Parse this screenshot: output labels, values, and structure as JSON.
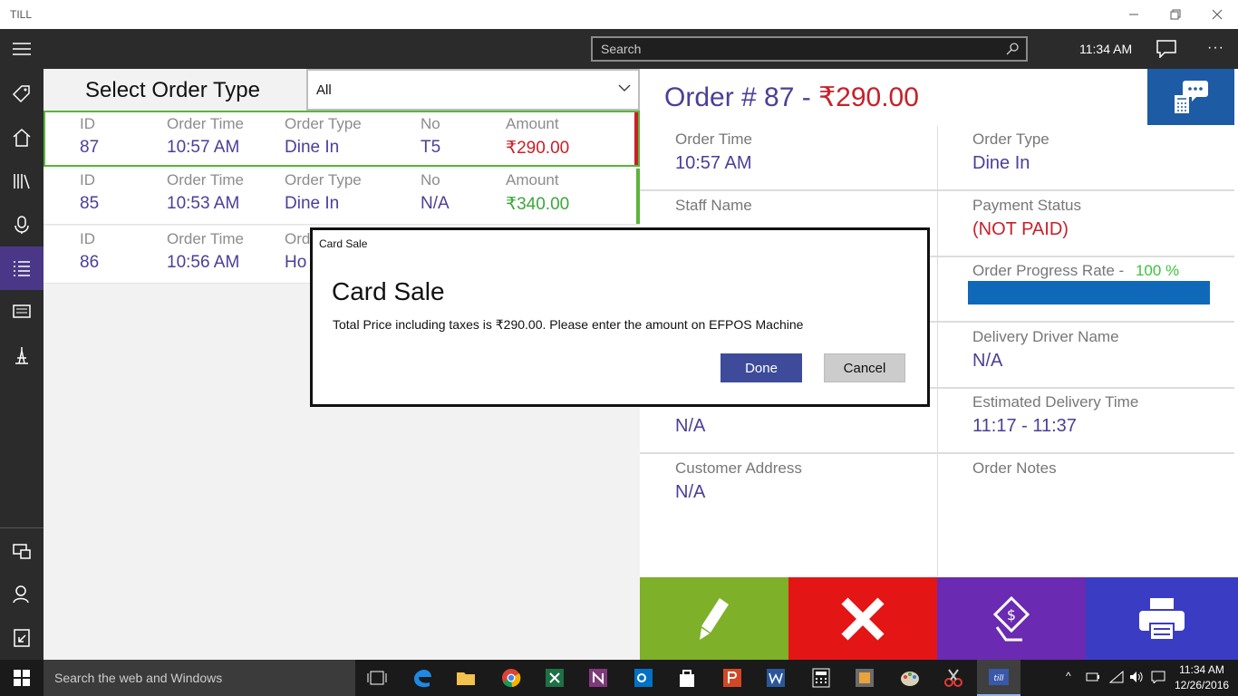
{
  "window": {
    "title": "TILL"
  },
  "cmdbar": {
    "search_placeholder": "Search",
    "time": "11:34 AM"
  },
  "left": {
    "title": "Select Order Type",
    "filter_value": "All",
    "orders": [
      {
        "id_label": "ID",
        "id": "87",
        "time_label": "Order Time",
        "time": "10:57 AM",
        "type_label": "Order Type",
        "type": "Dine In",
        "no_label": "No",
        "no": "T5",
        "amount_label": "Amount",
        "amount": "₹290.00",
        "amount_color": "#c8202a",
        "accent": "#c8202a"
      },
      {
        "id_label": "ID",
        "id": "85",
        "time_label": "Order Time",
        "time": "10:53 AM",
        "type_label": "Order Type",
        "type": "Dine In",
        "no_label": "No",
        "no": "N/A",
        "amount_label": "Amount",
        "amount": "₹340.00",
        "amount_color": "#3aa83a",
        "accent": "#5bb43c"
      },
      {
        "id_label": "ID",
        "id": "86",
        "time_label": "Order Time",
        "time": "10:56 AM",
        "type_label": "Order",
        "type": "Ho",
        "no_label": "",
        "no": "",
        "amount_label": "",
        "amount": "",
        "amount_color": "#4a3f98",
        "accent": "#5bb43c"
      }
    ]
  },
  "detail": {
    "title_prefix": "Order # 87 - ",
    "title_amount": "₹290.00",
    "order_time_label": "Order Time",
    "order_time": "10:57 AM",
    "order_type_label": "Order Type",
    "order_type": "Dine In",
    "staff_label": "Staff Name",
    "payment_label": "Payment Status",
    "payment": "(NOT PAID)",
    "progress_label": "Order Progress Rate - ",
    "progress": "100 %",
    "progress_value": 1.0,
    "driver_label": "Delivery Driver Name",
    "driver": "N/A",
    "phone_value": "N/A",
    "est_label": "Estimated Delivery Time",
    "est": "11:17  -  11:37",
    "address_label": "Customer Address",
    "address": "N/A",
    "notes_label": "Order Notes"
  },
  "actions": [
    {
      "name": "edit",
      "color": "#7fb02a"
    },
    {
      "name": "cancel",
      "color": "#e41515"
    },
    {
      "name": "pay",
      "color": "#6a2ab1"
    },
    {
      "name": "print",
      "color": "#3b3cc4"
    }
  ],
  "dialog": {
    "title": "Card Sale",
    "heading": "Card Sale",
    "message": "Total Price including taxes is ₹290.00. Please enter the amount on EFPOS Machine",
    "done": "Done",
    "cancel": "Cancel"
  },
  "taskbar": {
    "search_placeholder": "Search the web and Windows",
    "time": "11:34 AM",
    "date": "12/26/2016"
  }
}
